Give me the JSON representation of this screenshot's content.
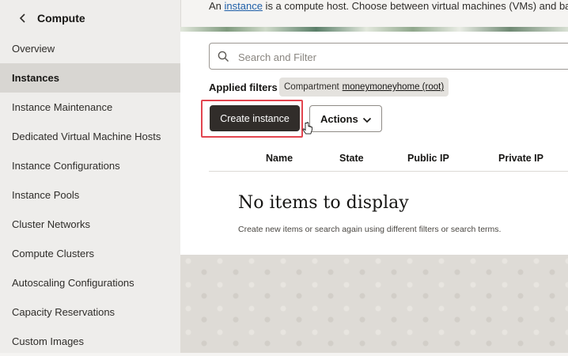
{
  "sidebar": {
    "title": "Compute",
    "back_icon": "chevron-left-icon",
    "items": [
      {
        "label": "Overview",
        "active": false
      },
      {
        "label": "Instances",
        "active": true
      },
      {
        "label": "Instance Maintenance",
        "active": false
      },
      {
        "label": "Dedicated Virtual Machine Hosts",
        "active": false
      },
      {
        "label": "Instance Configurations",
        "active": false
      },
      {
        "label": "Instance Pools",
        "active": false
      },
      {
        "label": "Cluster Networks",
        "active": false
      },
      {
        "label": "Compute Clusters",
        "active": false
      },
      {
        "label": "Autoscaling Configurations",
        "active": false
      },
      {
        "label": "Capacity Reservations",
        "active": false
      },
      {
        "label": "Custom Images",
        "active": false
      }
    ]
  },
  "intro": {
    "prefix": "An ",
    "link": "instance",
    "suffix": " is a compute host. Choose between virtual machines (VMs) and bare m"
  },
  "search": {
    "placeholder": "Search and Filter",
    "value": "",
    "icon": "search-icon"
  },
  "filters": {
    "label": "Applied filters",
    "chip_label": "Compartment",
    "chip_value": "moneymoneyhome (root)"
  },
  "toolbar": {
    "create_label": "Create instance",
    "actions_label": "Actions",
    "actions_icon": "chevron-down-icon"
  },
  "table": {
    "columns": [
      "Name",
      "State",
      "Public IP",
      "Private IP"
    ]
  },
  "empty_state": {
    "title": "No items to display",
    "subtitle": "Create new items or search again using different filters or search terms."
  },
  "colors": {
    "primary_button": "#312d2a",
    "highlight": "#e2454f",
    "link": "#1f5fa8",
    "sidebar_active": "#d8d6d2"
  }
}
